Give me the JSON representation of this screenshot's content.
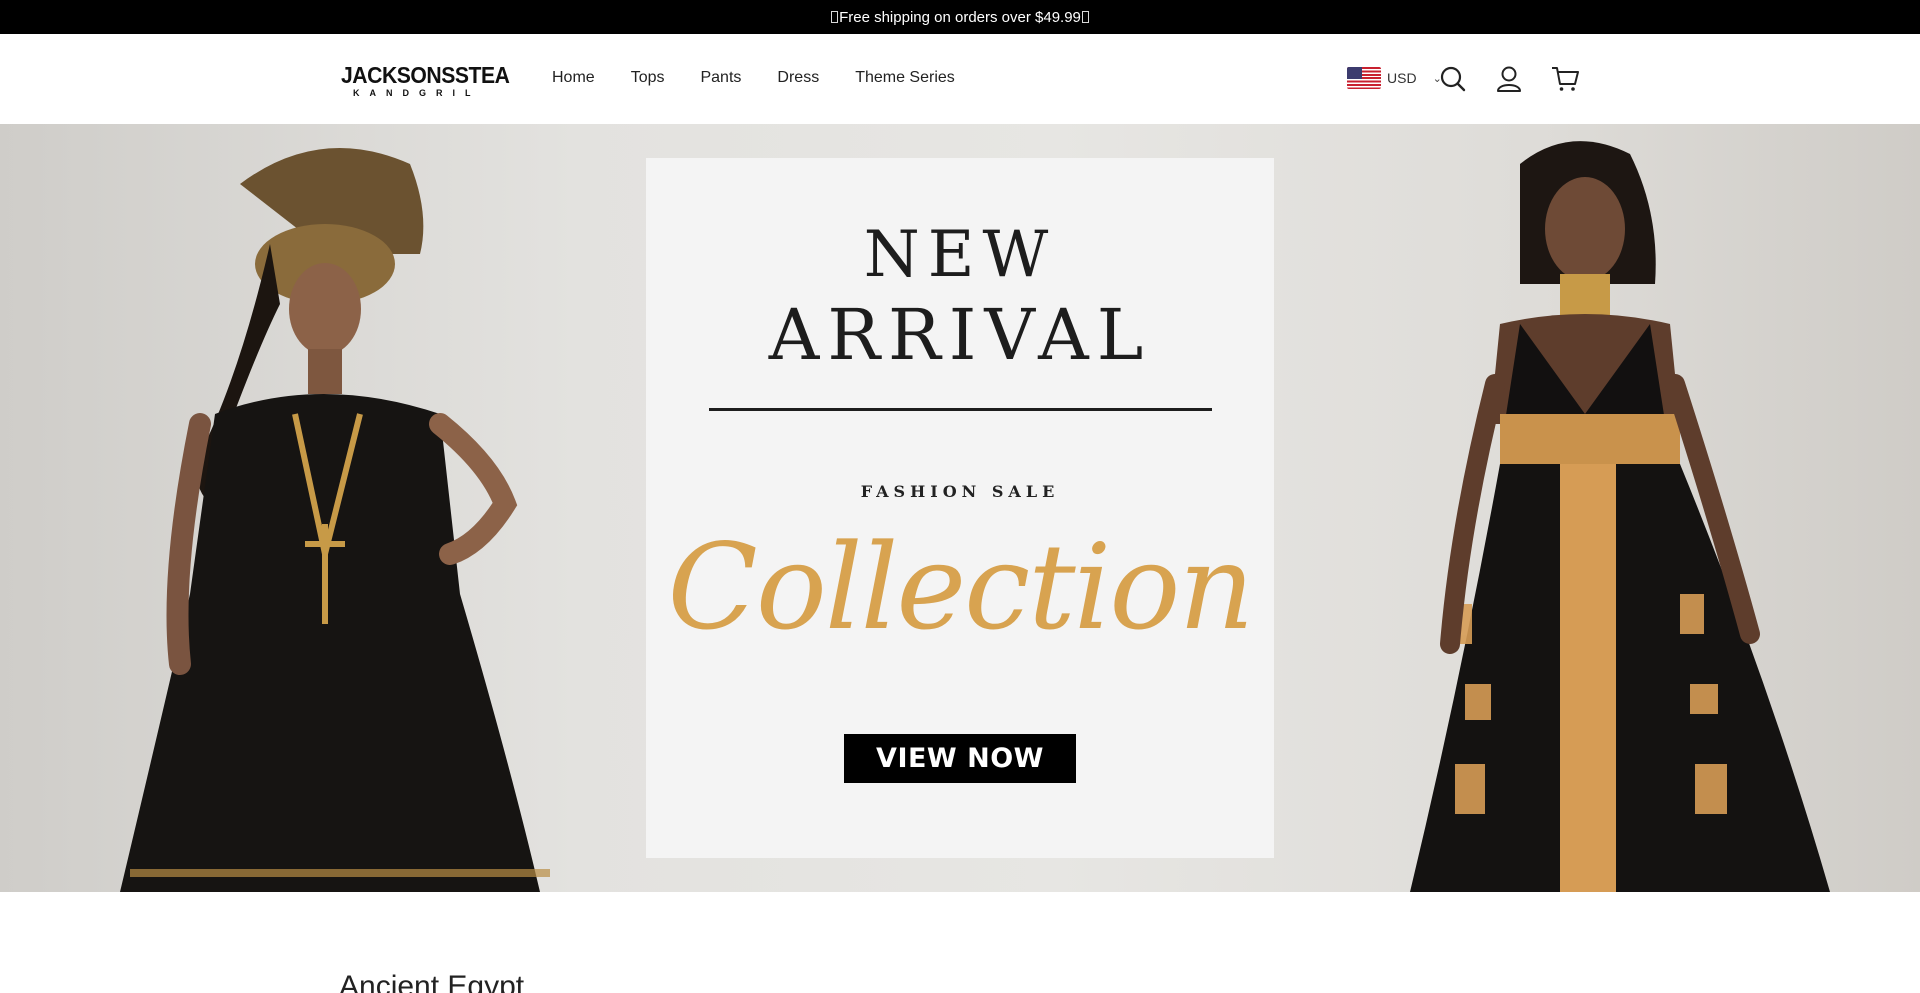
{
  "announcement": {
    "text": "Free shipping on orders over $49.99"
  },
  "header": {
    "logo_main": "JACKSONSSTEA",
    "logo_sub": "KANDGRIL",
    "nav": [
      {
        "label": "Home"
      },
      {
        "label": "Tops"
      },
      {
        "label": "Pants"
      },
      {
        "label": "Dress"
      },
      {
        "label": "Theme Series"
      }
    ],
    "currency": {
      "code": "USD",
      "flag": "us-flag-icon"
    },
    "icons": [
      "search-icon",
      "account-icon",
      "cart-icon"
    ]
  },
  "hero": {
    "line1": "NEW",
    "line2": "ARRIVAL",
    "tagline": "FASHION SALE",
    "script": "Collection",
    "button": "VIEW NOW",
    "colors": {
      "gold": "#d8a350",
      "panel": "#f4f4f4",
      "button": "#000000"
    }
  },
  "section": {
    "title": "Ancient Egypt"
  }
}
